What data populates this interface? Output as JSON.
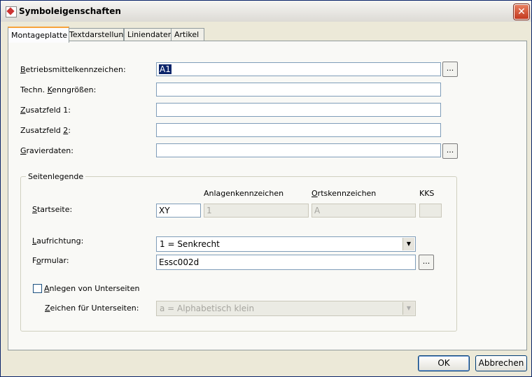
{
  "window": {
    "title": "Symboleigenschaften",
    "close_glyph": "✕"
  },
  "tabs": [
    {
      "label": "Montageplatte",
      "active": true
    },
    {
      "label": "Textdarstellung",
      "active": false
    },
    {
      "label": "Liniendaten",
      "active": false
    },
    {
      "label": "Artikel",
      "active": false
    }
  ],
  "fields": {
    "betriebsmittel": {
      "label_pre": "",
      "label_u": "B",
      "label_post": "etriebsmittelkennzeichen:",
      "value": "A1"
    },
    "techn": {
      "label_pre": "Techn. ",
      "label_u": "K",
      "label_post": "enngrößen:",
      "value": ""
    },
    "zusatz1": {
      "label_pre": "",
      "label_u": "Z",
      "label_post": "usatzfeld 1:",
      "value": ""
    },
    "zusatz2": {
      "label_pre": "Zusatzfeld ",
      "label_u": "2",
      "label_post": ":",
      "value": ""
    },
    "gravier": {
      "label_pre": "",
      "label_u": "G",
      "label_post": "ravierdaten:",
      "value": ""
    },
    "browse_label": "..."
  },
  "seitenlegende": {
    "title": "Seitenlegende",
    "col_anlagen": "Anlagenkennzeichen",
    "col_orts_pre": "",
    "col_orts_u": "O",
    "col_orts_post": "rtskennzeichen",
    "col_kks": "KKS",
    "startseite": {
      "label_pre": "",
      "label_u": "S",
      "label_post": "tartseite:",
      "value": "XY",
      "anlagen": "1",
      "orts": "A",
      "kks": ""
    },
    "laufrichtung": {
      "label_pre": "",
      "label_u": "L",
      "label_post": "aufrichtung:",
      "value": "1 = Senkrecht"
    },
    "formular": {
      "label_pre": "F",
      "label_u": "o",
      "label_post": "rmular:",
      "value": "Essc002d"
    },
    "unterseiten": {
      "checked": false,
      "label_pre": "",
      "label_u": "A",
      "label_post": "nlegen von Unterseiten"
    },
    "zeichen": {
      "label_pre": "",
      "label_u": "Z",
      "label_post": "eichen für Unterseiten:",
      "value": "a = Alphabetisch klein"
    }
  },
  "buttons": {
    "ok": "OK",
    "cancel": "Abbrechen"
  },
  "colors": {
    "selection": "#0a246a",
    "tab_accent": "#f7a33a"
  }
}
